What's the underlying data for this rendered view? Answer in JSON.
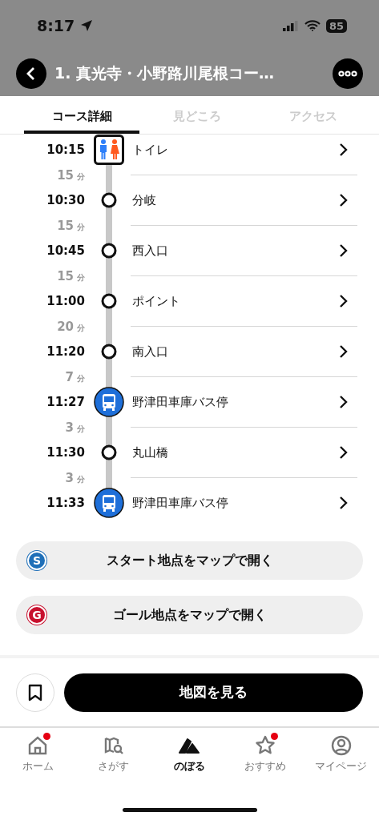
{
  "status_bar": {
    "time": "8:17",
    "battery": "85"
  },
  "header": {
    "title": "1. 真光寺・小野路川尾根コー…"
  },
  "tabs": [
    {
      "label": "コース詳細",
      "selected": true
    },
    {
      "label": "見どころ",
      "selected": false
    },
    {
      "label": "アクセス",
      "selected": false
    }
  ],
  "stops": [
    {
      "time": "10:15",
      "kind": "toilet",
      "name": "トイレ",
      "walk": {
        "value": "15",
        "unit": "分"
      }
    },
    {
      "time": "10:30",
      "kind": "point",
      "name": "分岐",
      "walk": {
        "value": "15",
        "unit": "分"
      }
    },
    {
      "time": "10:45",
      "kind": "point",
      "name": "西入口",
      "walk": {
        "value": "15",
        "unit": "分"
      }
    },
    {
      "time": "11:00",
      "kind": "point",
      "name": "ポイント",
      "walk": {
        "value": "20",
        "unit": "分"
      }
    },
    {
      "time": "11:20",
      "kind": "point",
      "name": "南入口",
      "walk": {
        "value": "7",
        "unit": "分"
      }
    },
    {
      "time": "11:27",
      "kind": "bus",
      "name": "野津田車庫バス停",
      "walk": {
        "value": "3",
        "unit": "分"
      }
    },
    {
      "time": "11:30",
      "kind": "point",
      "name": "丸山橋",
      "walk": {
        "value": "3",
        "unit": "分"
      }
    },
    {
      "time": "11:33",
      "kind": "bus",
      "name": "野津田車庫バス停"
    }
  ],
  "map_buttons": [
    {
      "badge": "S",
      "color": "#1e6fb8",
      "label": "スタート地点をマップで開く"
    },
    {
      "badge": "G",
      "color": "#c8102e",
      "label": "ゴール地点をマップで開く"
    }
  ],
  "action_bar": {
    "bookmarked": false,
    "button": "地図を見る"
  },
  "nav": [
    {
      "kind": "home",
      "label": "ホーム",
      "selected": false,
      "dot": true
    },
    {
      "kind": "search",
      "label": "さがす",
      "selected": false,
      "dot": false
    },
    {
      "kind": "climb",
      "label": "のぼる",
      "selected": true,
      "dot": false
    },
    {
      "kind": "recommend",
      "label": "おすすめ",
      "selected": false,
      "dot": true
    },
    {
      "kind": "mypage",
      "label": "マイページ",
      "selected": false,
      "dot": false
    }
  ]
}
